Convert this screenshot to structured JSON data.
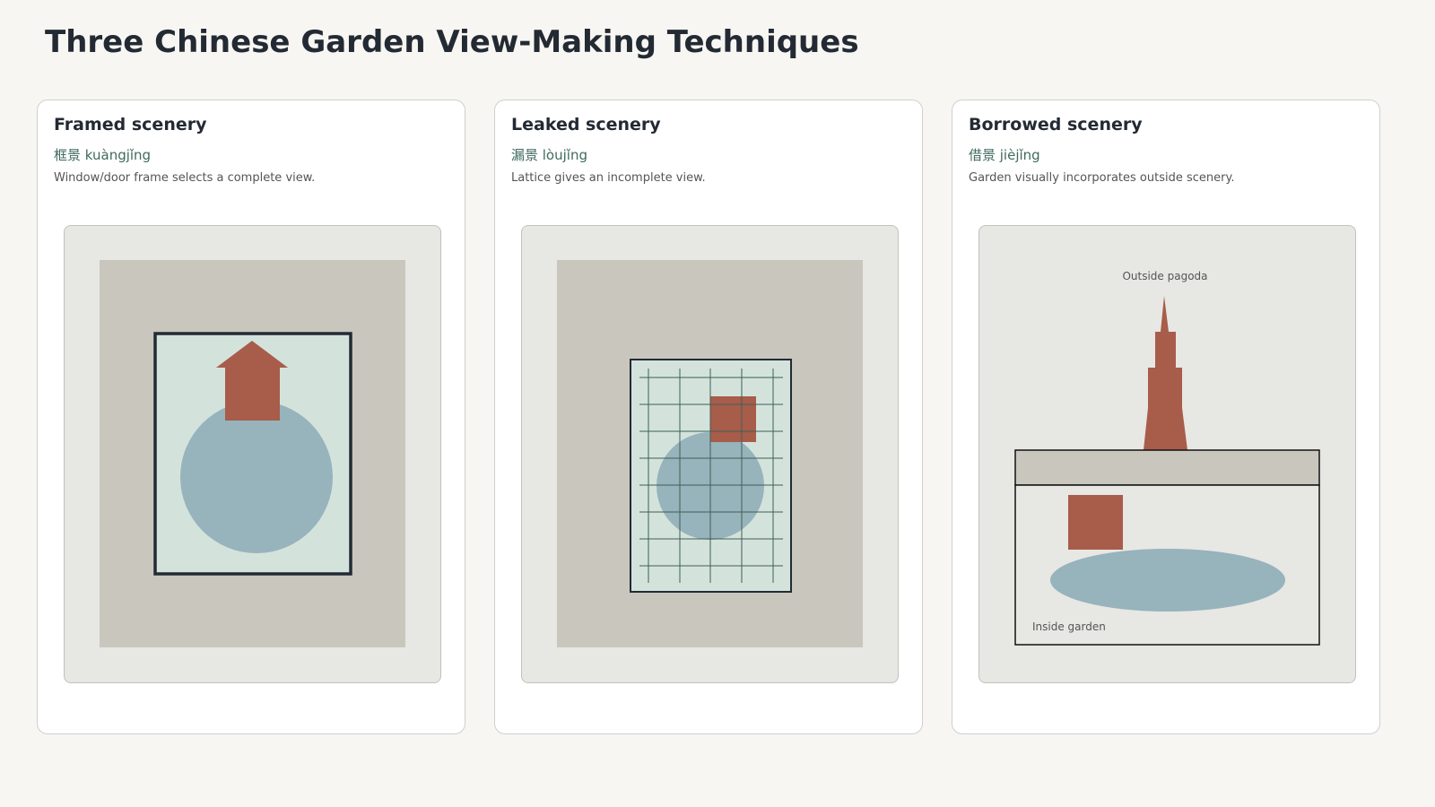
{
  "page": {
    "title": "Three Chinese Garden View-Making Techniques"
  },
  "colors": {
    "background": "#f7f6f2",
    "card": "#ffffff",
    "panel": "#e7e7e3",
    "wall": "#c9c6be",
    "view": "#d3e3dc",
    "water": "#97b3bc",
    "building": "#a85c4a",
    "frame": "#232a33",
    "lattice": "#3f5f55",
    "pinyin": "#3f6a5f"
  },
  "cards": [
    {
      "title": "Framed scenery",
      "subtitle": "框景 kuàngjǐng",
      "description": "Window/door frame selects a complete view."
    },
    {
      "title": "Leaked scenery",
      "subtitle": "漏景 lòujǐng",
      "description": "Lattice gives an incomplete view."
    },
    {
      "title": "Borrowed scenery",
      "subtitle": "借景 jièjǐng",
      "description": "Garden visually incorporates outside scenery.",
      "labels": {
        "outside": "Outside pagoda",
        "inside": "Inside garden"
      }
    }
  ]
}
